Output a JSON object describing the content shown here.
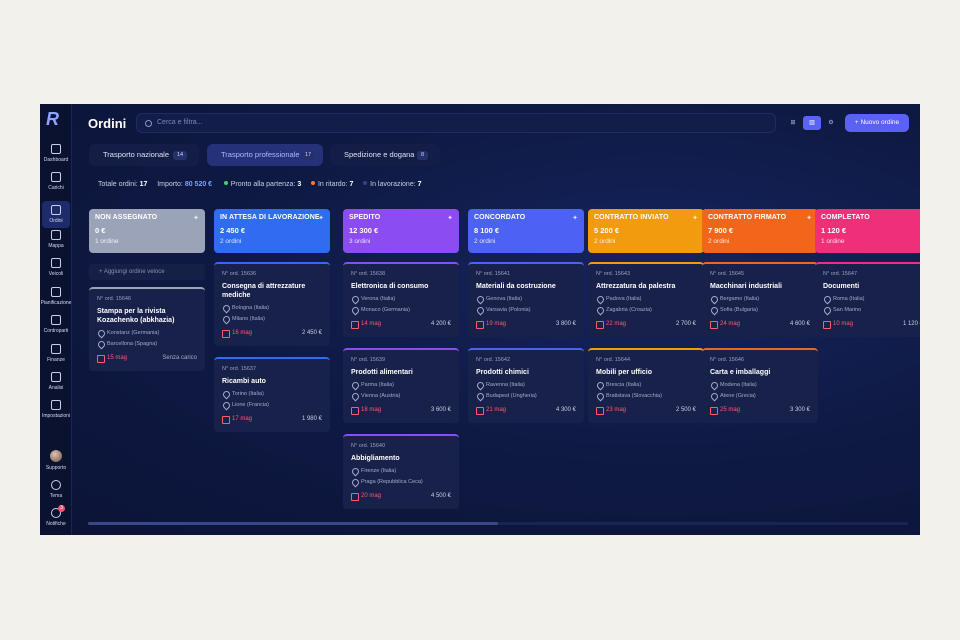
{
  "app": {
    "title": "Ordini"
  },
  "search": {
    "placeholder": "Cerca e filtra..."
  },
  "toolbar": {
    "view_labels": [
      "⊞",
      "▥",
      "⚙"
    ],
    "new_label": "+  Nuovo ordine"
  },
  "sidebar": {
    "items": [
      {
        "label": "Dashboard",
        "icon": "dashboard-icon"
      },
      {
        "label": "Carichi",
        "icon": "truck-icon"
      },
      {
        "label": "Ordini",
        "icon": "orders-icon"
      },
      {
        "label": "Mappa",
        "icon": "map-icon"
      },
      {
        "label": "Veicoli",
        "icon": "vehicle-icon"
      },
      {
        "label": "Pianificazione",
        "icon": "calendar-icon"
      },
      {
        "label": "Controparti",
        "icon": "people-icon"
      },
      {
        "label": "Finanze",
        "icon": "finance-icon"
      },
      {
        "label": "Analisi",
        "icon": "chart-icon"
      },
      {
        "label": "Impostazioni",
        "icon": "gear-icon"
      }
    ],
    "bottom": [
      {
        "label": "Supporto"
      },
      {
        "label": "Tema"
      },
      {
        "label": "Notifiche",
        "badge": "3"
      }
    ]
  },
  "tabs": [
    {
      "label": "Trasporto nazionale",
      "count": "14"
    },
    {
      "label": "Trasporto professionale",
      "count": "17"
    },
    {
      "label": "Spedizione e dogana",
      "count": "8"
    }
  ],
  "stats": {
    "total_label": "Totale ordini:",
    "total": "17",
    "amount_label": "Importo:",
    "amount": "80 520 €",
    "ready_label": "Pronto alla partenza:",
    "ready": "3",
    "late_label": "In ritardo:",
    "late": "7",
    "working_label": "In lavorazione:",
    "working": "7"
  },
  "columns": [
    {
      "name": "NON ASSEGNATO",
      "total": "0 €",
      "count": "1 ordine",
      "color": "#9aa3b8",
      "add_label": "+ Aggiungi ordine veloce",
      "cards": [
        {
          "no": "N° ord. 15646",
          "title": "Stampa per la rivista Kozachenko (abkhazia)",
          "from": "Konstanz (Germania)",
          "to": "Barcellona (Spagna)",
          "date": "15 mag",
          "extra": "Senza carico"
        }
      ]
    },
    {
      "name": "IN ATTESA DI LAVORAZIONE",
      "total": "2 450 €",
      "count": "2 ordini",
      "color": "#2f6cf0",
      "cards": [
        {
          "no": "N° ord. 15636",
          "title": "Consegna di attrezzature mediche",
          "from": "Bologna (Italia)",
          "to": "Milano (Italia)",
          "date": "16 mag",
          "extra": "2 450 €"
        },
        {
          "no": "N° ord. 15637",
          "title": "Ricambi auto",
          "from": "Torino (Italia)",
          "to": "Lione (Francia)",
          "date": "17 mag",
          "extra": "1 980 €"
        }
      ]
    },
    {
      "name": "SPEDITO",
      "total": "12 300 €",
      "count": "3 ordini",
      "color": "#8b4df2",
      "cards": [
        {
          "no": "N° ord. 15638",
          "title": "Elettronica di consumo",
          "from": "Verona (Italia)",
          "to": "Monaco (Germania)",
          "date": "14 mag",
          "extra": "4 200 €"
        },
        {
          "no": "N° ord. 15639",
          "title": "Prodotti alimentari",
          "from": "Parma (Italia)",
          "to": "Vienna (Austria)",
          "date": "18 mag",
          "extra": "3 600 €"
        },
        {
          "no": "N° ord. 15640",
          "title": "Abbigliamento",
          "from": "Firenze (Italia)",
          "to": "Praga (Repubblica Ceca)",
          "date": "20 mag",
          "extra": "4 500 €"
        }
      ]
    },
    {
      "name": "CONCORDATO",
      "total": "8 100 €",
      "count": "2 ordini",
      "color": "#4b62f2",
      "cards": [
        {
          "no": "N° ord. 15641",
          "title": "Materiali da costruzione",
          "from": "Genova (Italia)",
          "to": "Varsavia (Polonia)",
          "date": "19 mag",
          "extra": "3 800 €"
        },
        {
          "no": "N° ord. 15642",
          "title": "Prodotti chimici",
          "from": "Ravenna (Italia)",
          "to": "Budapest (Ungheria)",
          "date": "21 mag",
          "extra": "4 300 €"
        }
      ]
    },
    {
      "name": "CONTRATTO INVIATO",
      "total": "5 200 €",
      "count": "2 ordini",
      "color": "#f29b0f",
      "cards": [
        {
          "no": "N° ord. 15643",
          "title": "Attrezzatura da palestra",
          "from": "Padova (Italia)",
          "to": "Zagabria (Croazia)",
          "date": "22 mag",
          "extra": "2 700 €"
        },
        {
          "no": "N° ord. 15644",
          "title": "Mobili per ufficio",
          "from": "Brescia (Italia)",
          "to": "Bratislava (Slovacchia)",
          "date": "23 mag",
          "extra": "2 500 €"
        }
      ]
    },
    {
      "name": "CONTRATTO FIRMATO",
      "total": "7 900 €",
      "count": "2 ordini",
      "color": "#f2661c",
      "cards": [
        {
          "no": "N° ord. 15645",
          "title": "Macchinari industriali",
          "from": "Bergamo (Italia)",
          "to": "Sofia (Bulgaria)",
          "date": "24 mag",
          "extra": "4 600 €"
        },
        {
          "no": "N° ord. 15646",
          "title": "Carta e imballaggi",
          "from": "Modena (Italia)",
          "to": "Atene (Grecia)",
          "date": "25 mag",
          "extra": "3 300 €"
        }
      ]
    },
    {
      "name": "COMPLETATO",
      "total": "1 120 €",
      "count": "1 ordine",
      "color": "#ef2f78",
      "cards": [
        {
          "no": "N° ord. 15647",
          "title": "Documenti",
          "from": "Roma (Italia)",
          "to": "San Marino",
          "date": "10 mag",
          "extra": "1 120 €"
        }
      ]
    }
  ]
}
